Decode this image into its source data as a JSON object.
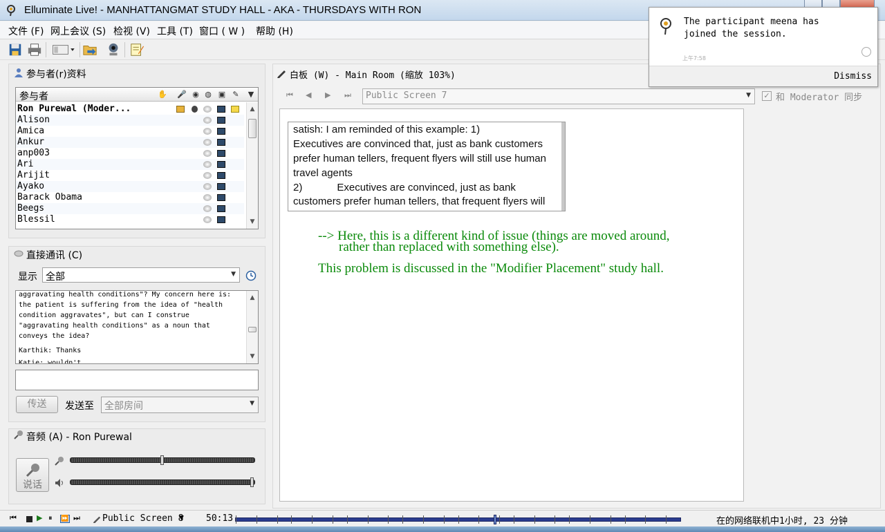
{
  "window": {
    "title": "Elluminate Live! - MANHATTANGMAT STUDY HALL - AKA - THURSDAYS WITH RON"
  },
  "menu": [
    {
      "label": "文件 (F)"
    },
    {
      "label": "网上会议 (S)"
    },
    {
      "label": "检视 (V)"
    },
    {
      "label": "工具 (T)"
    },
    {
      "label": "窗口 ( W )"
    },
    {
      "label": "帮助 (H)"
    }
  ],
  "toolbar": {
    "icons": [
      "save-icon",
      "print-icon",
      "layout-dropdown-icon",
      "load-content-icon",
      "webcam-icon",
      "notes-icon"
    ]
  },
  "participants": {
    "title": "参与者(r)资料",
    "column_header": "参与者",
    "columns": [
      "hand-raise-icon",
      "microphone-icon",
      "webcam-icon",
      "chat-icon",
      "whiteboard-icon",
      "pen-icon"
    ],
    "rows": [
      {
        "name": "Ron Purewal (Moder...",
        "moderator": true
      },
      {
        "name": "Alison"
      },
      {
        "name": "Amica"
      },
      {
        "name": "Ankur"
      },
      {
        "name": "anp003"
      },
      {
        "name": "Ari"
      },
      {
        "name": "Arijit"
      },
      {
        "name": "Ayako"
      },
      {
        "name": "Barack Obama"
      },
      {
        "name": "Beegs"
      },
      {
        "name": "Blessil"
      }
    ]
  },
  "chat": {
    "title": "直接通讯 (C)",
    "filter_label": "显示",
    "filter_value": "全部",
    "messages": [
      {
        "text": "aggravating health conditions\"? My concern here is:\nthe patient is suffering from the idea of \"health\ncondition aggravates\", but can I construe\n\"aggravating health conditions\" as a noun that\nconveys the idea?"
      },
      {
        "text": "Karthik: Thanks"
      },
      {
        "text": "Katie: wouldn't..."
      }
    ],
    "input_value": "",
    "send_label": "传送",
    "send_to_label": "发送至",
    "send_to_value": "全部房间"
  },
  "audio": {
    "title": "音频 (A) - Ron Purewal",
    "talk_label": "说话",
    "mic_level": 0.5,
    "speaker_level": 1.0
  },
  "whiteboard": {
    "title": "白板 (W) - Main Room (缩放 103%)",
    "screen_value": "Public Screen 7",
    "sync_label": "和 Moderator 同步",
    "sync_checked": true,
    "image_lines": [
      "satish: I am reminded of this example: 1)",
      "Executives are convinced that, just as bank customers",
      "prefer human tellers, frequent flyers will still use human",
      "travel agents",
      "2)            Executives are convinced, just as bank",
      "customers prefer human tellers, that frequent flyers will"
    ],
    "annotation_line1": "--> Here, this is a different kind of issue (things are moved around,",
    "annotation_line2": "rather than replaced with something else).",
    "annotation_line3": "This problem is discussed in the \"Modifier Placement\" study hall.",
    "annotation_color": "#0a8a0a"
  },
  "notification": {
    "text": "The participant meena has\njoined the session.",
    "time": "上午7:58",
    "dismiss_label": "Dismiss"
  },
  "statusbar": {
    "screen_label": "Public Screen 8",
    "time": "50:13",
    "status": "在的网络联机中1小时, 23 分钟",
    "playback_progress": 0.58
  }
}
